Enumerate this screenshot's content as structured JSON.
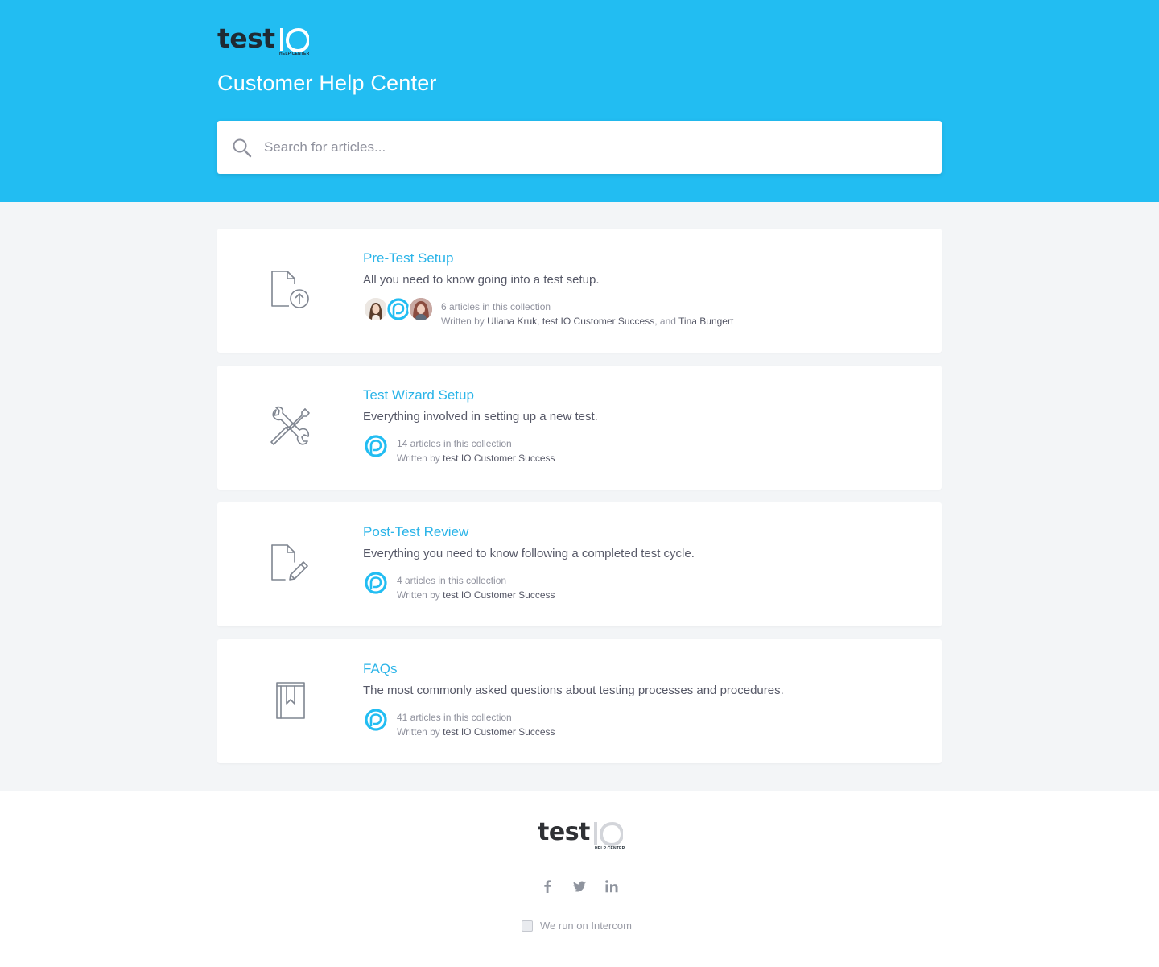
{
  "brand": {
    "logo_text": "test",
    "logo_sub": "HELP CENTER",
    "accent_color": "#22bdf2",
    "link_color": "#2bb4e8"
  },
  "header": {
    "title": "Customer Help Center"
  },
  "search": {
    "placeholder": "Search for articles..."
  },
  "collections": [
    {
      "title": "Pre-Test Setup",
      "description": "All you need to know going into a test setup.",
      "icon": "document-upload-icon",
      "count": "6 articles in this collection",
      "written_by": "Written by",
      "authors": [
        {
          "name": "Uliana Kruk",
          "sep": ", "
        },
        {
          "name": "test IO Customer Success",
          "sep": ", and "
        },
        {
          "name": "Tina Bungert",
          "sep": ""
        }
      ]
    },
    {
      "title": "Test Wizard Setup",
      "description": "Everything involved in setting up a new test.",
      "icon": "wrench-tools-icon",
      "count": "14 articles in this collection",
      "written_by": "Written by",
      "authors": [
        {
          "name": "test IO Customer Success",
          "sep": ""
        }
      ]
    },
    {
      "title": "Post-Test Review",
      "description": "Everything you need to know following a completed test cycle.",
      "icon": "document-edit-icon",
      "count": "4 articles in this collection",
      "written_by": "Written by",
      "authors": [
        {
          "name": "test IO Customer Success",
          "sep": ""
        }
      ]
    },
    {
      "title": "FAQs",
      "description": "The most commonly asked questions about testing processes and procedures.",
      "icon": "bookmark-book-icon",
      "count": "41 articles in this collection",
      "written_by": "Written by",
      "authors": [
        {
          "name": "test IO Customer Success",
          "sep": ""
        }
      ]
    }
  ],
  "footer": {
    "social": [
      "facebook-icon",
      "twitter-icon",
      "linkedin-icon"
    ],
    "intercom": "We run on Intercom"
  }
}
